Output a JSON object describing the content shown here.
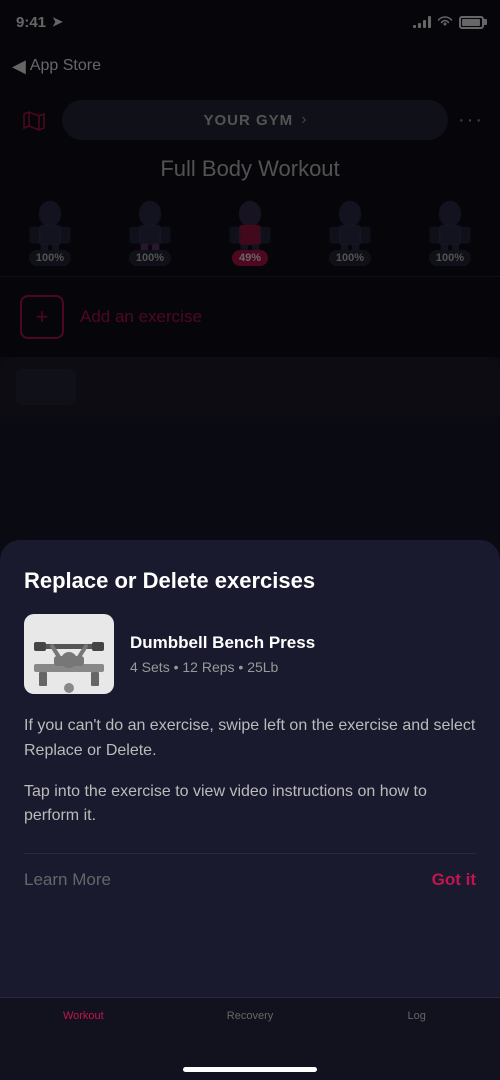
{
  "status_bar": {
    "time": "9:41",
    "back_nav": "App Store"
  },
  "gym_bar": {
    "gym_name": "YOUR GYM",
    "chevron": "›",
    "more_dots": "···"
  },
  "workout": {
    "title": "Full Body Workout"
  },
  "muscles": [
    {
      "label": "100%",
      "highlighted": false
    },
    {
      "label": "100%",
      "highlighted": false
    },
    {
      "label": "49%",
      "highlighted": true
    },
    {
      "label": "100%",
      "highlighted": false
    },
    {
      "label": "100%",
      "highlighted": false
    }
  ],
  "add_exercise": {
    "label": "Add an exercise"
  },
  "modal": {
    "title": "Replace or Delete exercises",
    "exercise": {
      "name": "Dumbbell Bench Press",
      "meta": "4 Sets • 12 Reps • 25Lb"
    },
    "instruction_1": "If you can't do an exercise, swipe left on the exercise and select Replace or Delete.",
    "instruction_2": "Tap into the exercise to view video instructions on how to perform it.",
    "learn_more": "Learn More",
    "got_it": "Got it"
  },
  "tab_bar": {
    "tabs": [
      {
        "label": "Workout",
        "active": true
      },
      {
        "label": "Recovery",
        "active": false
      },
      {
        "label": "Log",
        "active": false
      }
    ]
  }
}
